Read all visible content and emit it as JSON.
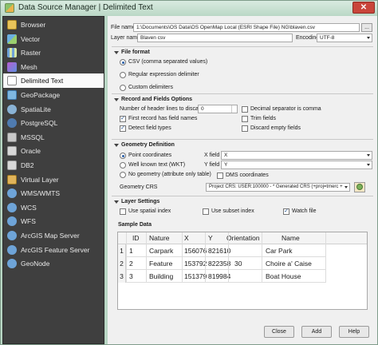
{
  "window": {
    "title": "Data Source Manager | Delimited Text",
    "close_glyph": "✕"
  },
  "sidebar": {
    "items": [
      {
        "label": "Browser",
        "icon": "browser-icon"
      },
      {
        "label": "Vector",
        "icon": "vector-icon"
      },
      {
        "label": "Raster",
        "icon": "raster-icon"
      },
      {
        "label": "Mesh",
        "icon": "mesh-icon"
      },
      {
        "label": "Delimited Text",
        "icon": "delimited-text-icon",
        "active": true
      },
      {
        "label": "GeoPackage",
        "icon": "geopackage-icon"
      },
      {
        "label": "SpatiaLite",
        "icon": "spatialite-icon"
      },
      {
        "label": "PostgreSQL",
        "icon": "postgresql-icon"
      },
      {
        "label": "MSSQL",
        "icon": "mssql-icon"
      },
      {
        "label": "Oracle",
        "icon": "oracle-icon"
      },
      {
        "label": "DB2",
        "icon": "db2-icon"
      },
      {
        "label": "Virtual Layer",
        "icon": "virtual-layer-icon"
      },
      {
        "label": "WMS/WMTS",
        "icon": "wms-icon"
      },
      {
        "label": "WCS",
        "icon": "wcs-icon"
      },
      {
        "label": "WFS",
        "icon": "wfs-icon"
      },
      {
        "label": "ArcGIS Map Server",
        "icon": "arcgis-map-icon"
      },
      {
        "label": "ArcGIS Feature Server",
        "icon": "arcgis-feature-icon"
      },
      {
        "label": "GeoNode",
        "icon": "geonode-icon"
      }
    ]
  },
  "file": {
    "file_name_label": "File name",
    "file_name_value": "1:\\Documents\\OS Data\\OS OpenMap Local (ESRI Shape File) NG\\blaven.csv",
    "browse_label": "...",
    "layer_name_label": "Layer name",
    "layer_name_value": "Blaven csv",
    "encoding_label": "Encoding",
    "encoding_value": "UTF-8"
  },
  "file_format": {
    "heading": "File format",
    "options": [
      "CSV (comma separated values)",
      "Regular expression delimiter",
      "Custom delimiters"
    ],
    "selected": 0
  },
  "records": {
    "heading": "Record and Fields Options",
    "header_lines_label": "Number of header lines to discard",
    "header_lines_value": "0",
    "first_record_label": "First record has field names",
    "first_record_checked": true,
    "detect_types_label": "Detect field types",
    "detect_types_checked": true,
    "decimal_comma_label": "Decimal separator is comma",
    "decimal_comma_checked": false,
    "trim_fields_label": "Trim fields",
    "trim_fields_checked": false,
    "discard_empty_label": "Discard empty fields",
    "discard_empty_checked": false
  },
  "geometry": {
    "heading": "Geometry Definition",
    "options": [
      "Point coordinates",
      "Well known text (WKT)",
      "No geometry (attribute only table)"
    ],
    "selected": 0,
    "x_field_label": "X field",
    "x_field_value": "X",
    "y_field_label": "Y field",
    "y_field_value": "Y",
    "dms_label": "DMS coordinates",
    "dms_checked": false,
    "crs_label": "Geometry CRS",
    "crs_value": "Project CRS: USER:100000 - * Generated CRS (+proj=tmerc +"
  },
  "layer_settings": {
    "heading": "Layer Settings",
    "spatial_index_label": "Use spatial index",
    "spatial_index_checked": false,
    "subset_index_label": "Use subset index",
    "subset_index_checked": false,
    "watch_file_label": "Watch file",
    "watch_file_checked": true
  },
  "sample": {
    "heading": "Sample Data",
    "columns": [
      "ID",
      "Nature",
      "X",
      "Y",
      "Orientation",
      "Name"
    ],
    "rows": [
      {
        "num": "1",
        "cells": [
          "1",
          "Carpark",
          "156076",
          "821610",
          "",
          "Car Park"
        ]
      },
      {
        "num": "2",
        "cells": [
          "2",
          "Feature",
          "153792",
          "822358",
          "30",
          "Choire a' Caise"
        ]
      },
      {
        "num": "3",
        "cells": [
          "3",
          "Building",
          "151379",
          "819984",
          "",
          "Boat House"
        ]
      }
    ]
  },
  "footer": {
    "close_label": "Close",
    "add_label": "Add",
    "help_label": "Help"
  }
}
